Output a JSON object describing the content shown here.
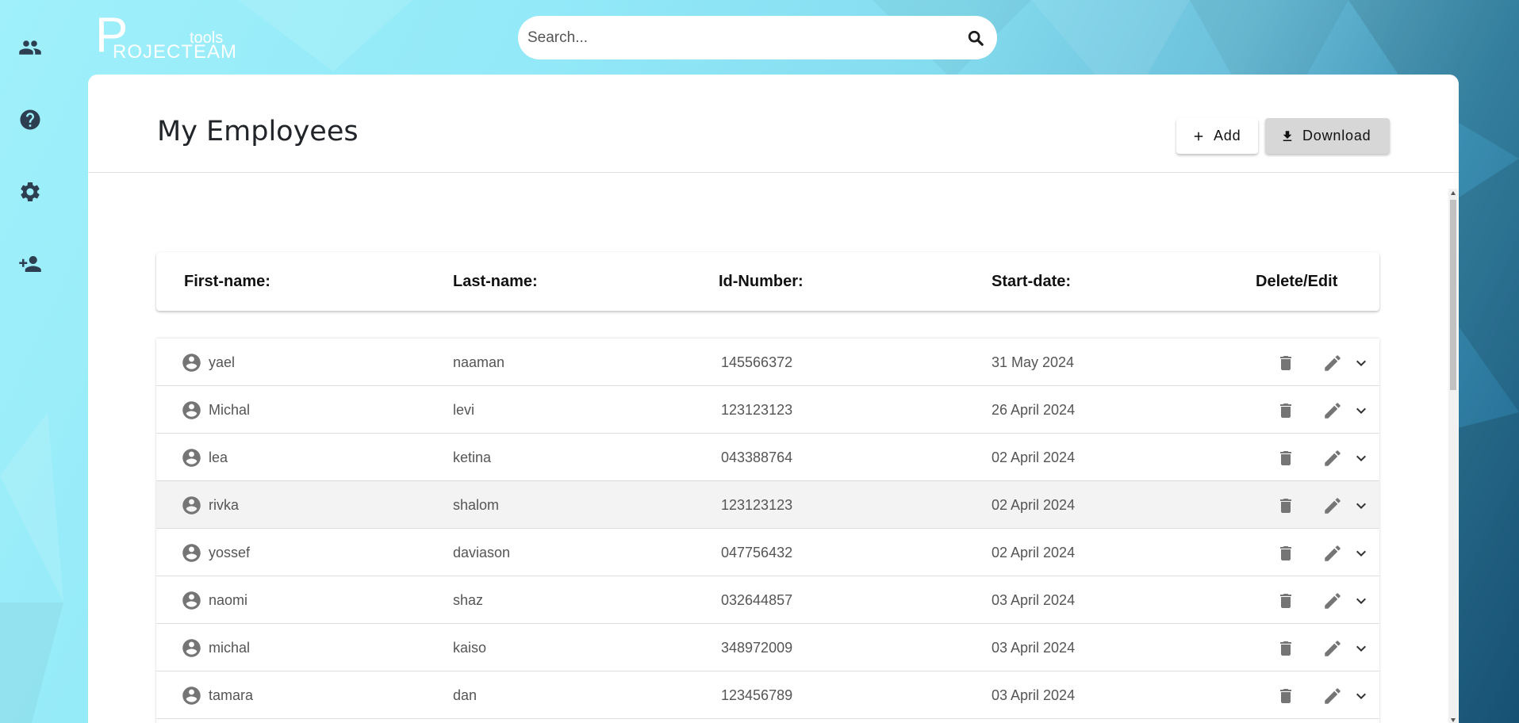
{
  "app": {
    "logo_initial": "P",
    "logo_rest": "ROJECTEAM",
    "logo_suffix": "tools"
  },
  "sidebar": {
    "items": [
      {
        "name": "employees",
        "icon": "people-icon"
      },
      {
        "name": "help",
        "icon": "help-icon"
      },
      {
        "name": "settings",
        "icon": "gear-icon"
      },
      {
        "name": "add-person",
        "icon": "person-add-icon"
      }
    ]
  },
  "search": {
    "placeholder": "Search...",
    "value": ""
  },
  "page": {
    "title": "My Employees",
    "add_label": "Add",
    "download_label": "Download"
  },
  "table": {
    "headers": {
      "first_name": "First-name:",
      "last_name": "Last-name:",
      "id_number": "Id-Number:",
      "start_date": "Start-date:",
      "actions": "Delete/Edit"
    },
    "rows": [
      {
        "first": "yael",
        "last": "naaman",
        "id": "145566372",
        "date": "31 May 2024"
      },
      {
        "first": "Michal",
        "last": "levi",
        "id": "123123123",
        "date": "26 April 2024"
      },
      {
        "first": "lea",
        "last": "ketina",
        "id": "043388764",
        "date": "02 April 2024"
      },
      {
        "first": "rivka",
        "last": "shalom",
        "id": "123123123",
        "date": "02 April 2024"
      },
      {
        "first": "yossef",
        "last": "daviason",
        "id": "047756432",
        "date": "02 April 2024"
      },
      {
        "first": "naomi",
        "last": "shaz",
        "id": "032644857",
        "date": "03 April 2024"
      },
      {
        "first": "michal",
        "last": "kaiso",
        "id": "348972009",
        "date": "03 April 2024"
      },
      {
        "first": "tamara",
        "last": "dan",
        "id": "123456789",
        "date": "03 April 2024"
      }
    ],
    "hovered_row_index": 3
  },
  "colors": {
    "sidebar_icon": "#2c3e50",
    "row_icon": "#757575",
    "download_bg": "#d7d7d7"
  }
}
